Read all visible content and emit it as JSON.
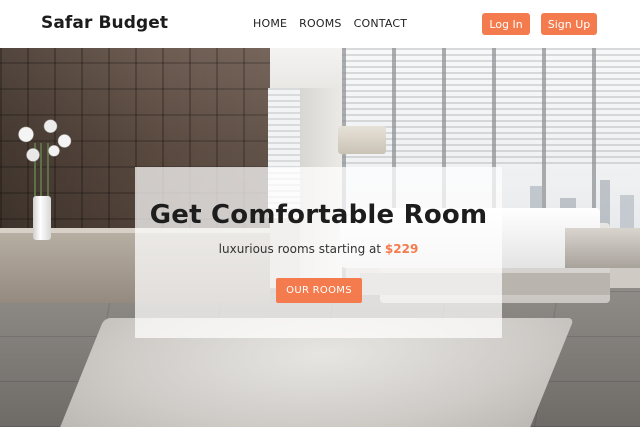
{
  "brand": "Safar Budget",
  "nav": {
    "items": [
      {
        "label": "HOME"
      },
      {
        "label": "ROOMS"
      },
      {
        "label": "CONTACT"
      }
    ]
  },
  "auth": {
    "login_label": "Log In",
    "signup_label": "Sign Up"
  },
  "hero": {
    "title": "Get Comfortable Room",
    "subtitle_prefix": "luxurious rooms starting at ",
    "price": "$229",
    "cta_label": "OUR ROOMS"
  },
  "colors": {
    "accent": "#f47b4d",
    "header_bg": "#ffffff",
    "text_dark": "#1d1d1d"
  }
}
